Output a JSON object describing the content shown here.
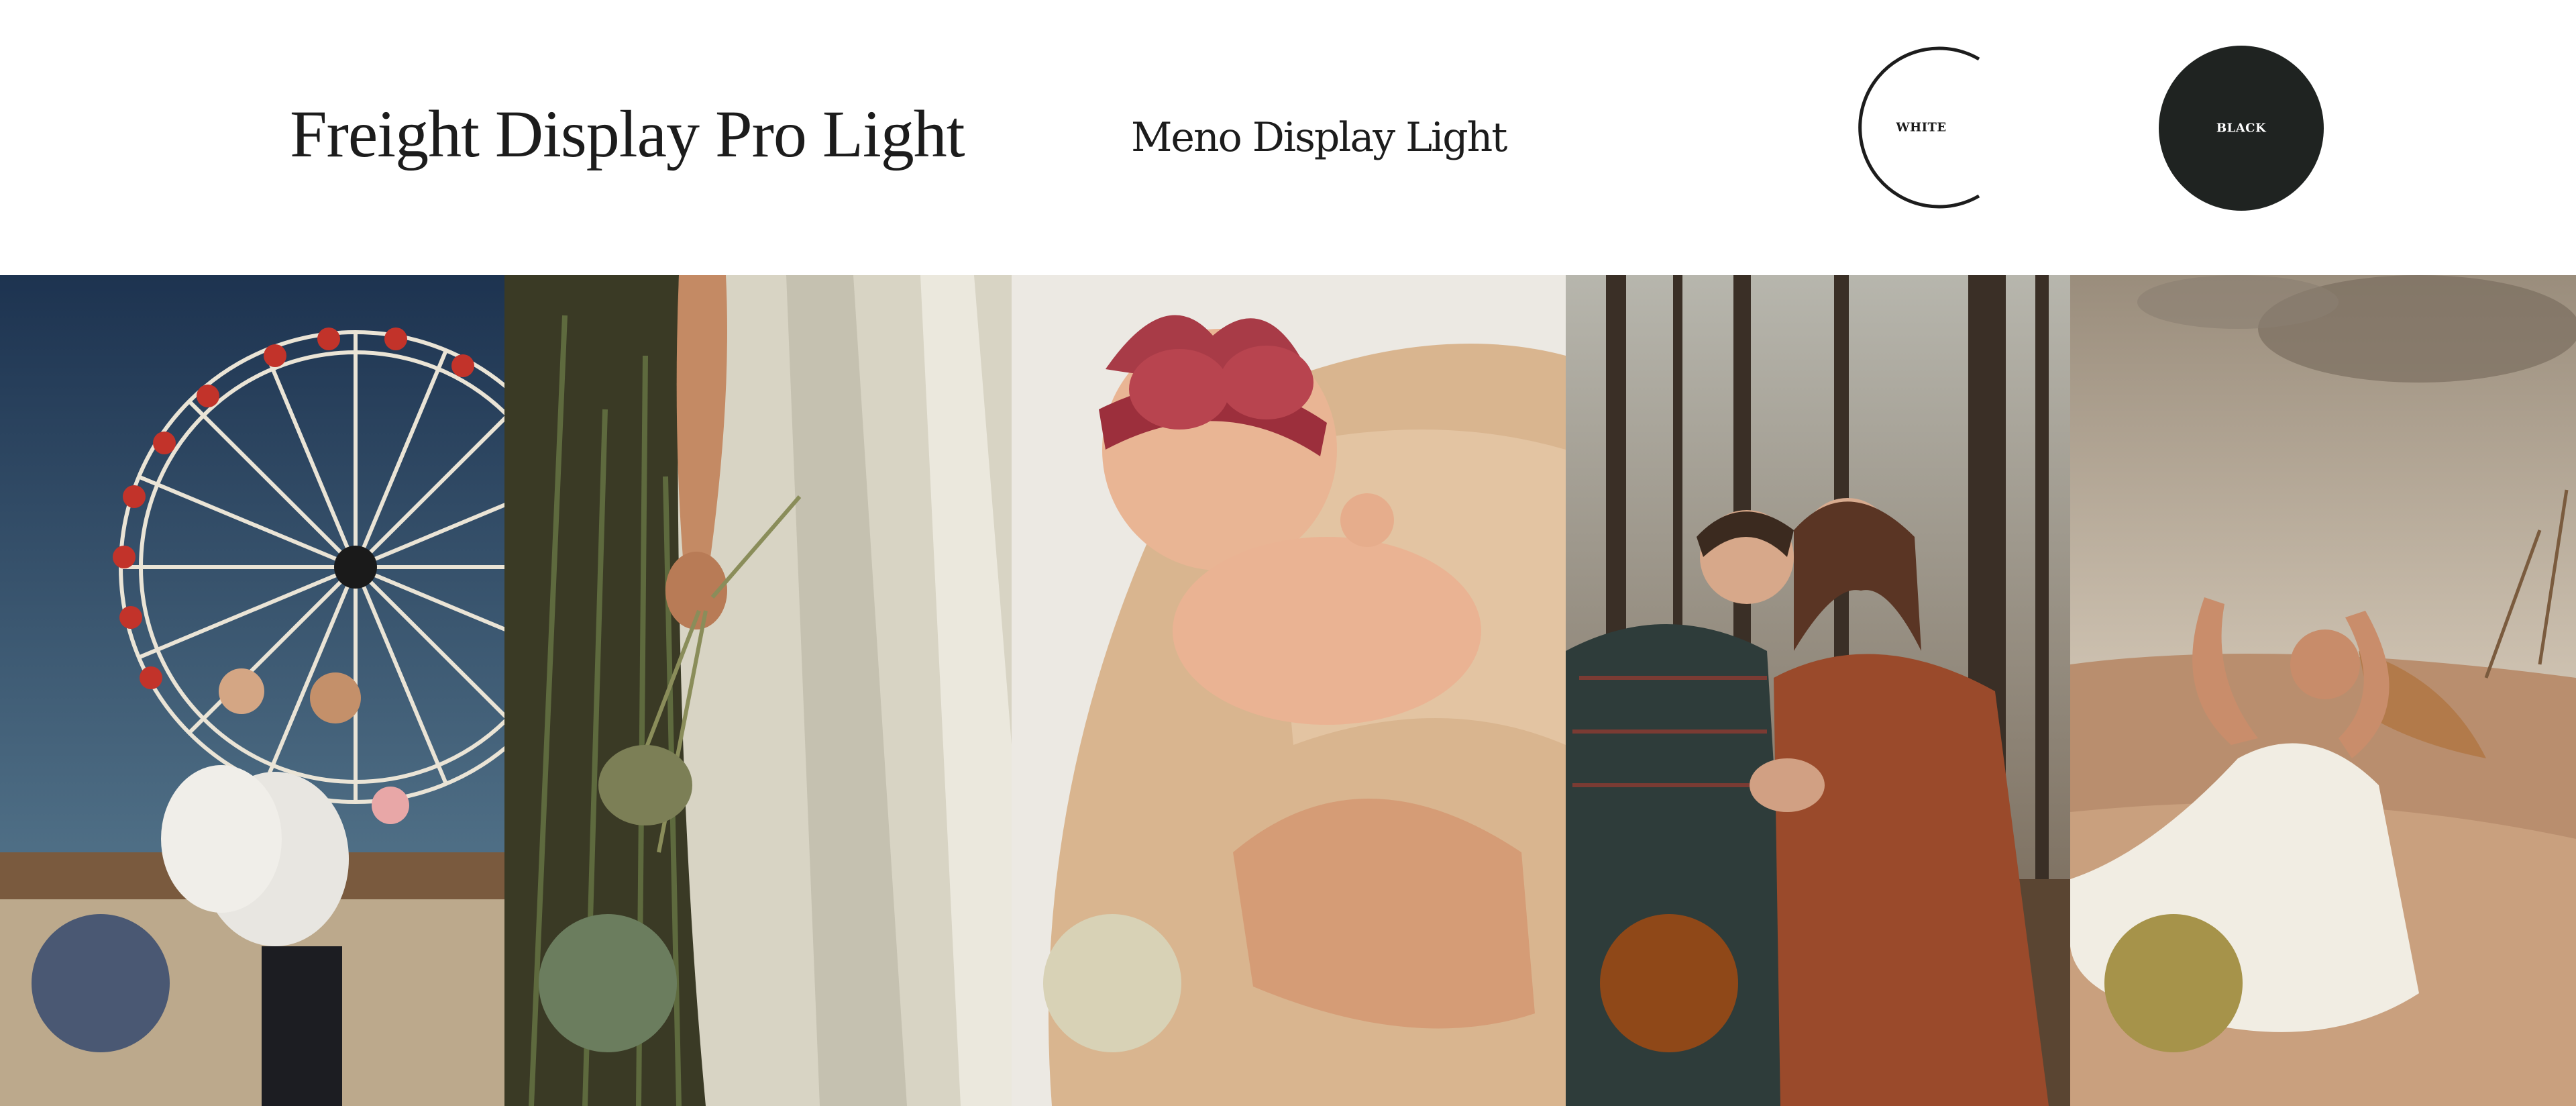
{
  "typography": {
    "heading_font_sample": "Freight Display Pro Light",
    "subheading_font_sample": "Meno Display Light"
  },
  "base_colors": [
    {
      "label": "WHITE",
      "hex": "#ffffff"
    },
    {
      "label": "BLACK",
      "hex": "#1f2321"
    }
  ],
  "photos": [
    {
      "icon": "ferris-wheel-couple-photo",
      "swatch_hex": "#4a5873"
    },
    {
      "icon": "dress-and-bouquet-photo",
      "swatch_hex": "#6b7d5e"
    },
    {
      "icon": "newborn-headband-photo",
      "swatch_hex": "#d8d2b6"
    },
    {
      "icon": "forest-couple-photo",
      "swatch_hex": "#8f4818"
    },
    {
      "icon": "dune-woman-photo",
      "swatch_hex": "#a6934a"
    }
  ]
}
